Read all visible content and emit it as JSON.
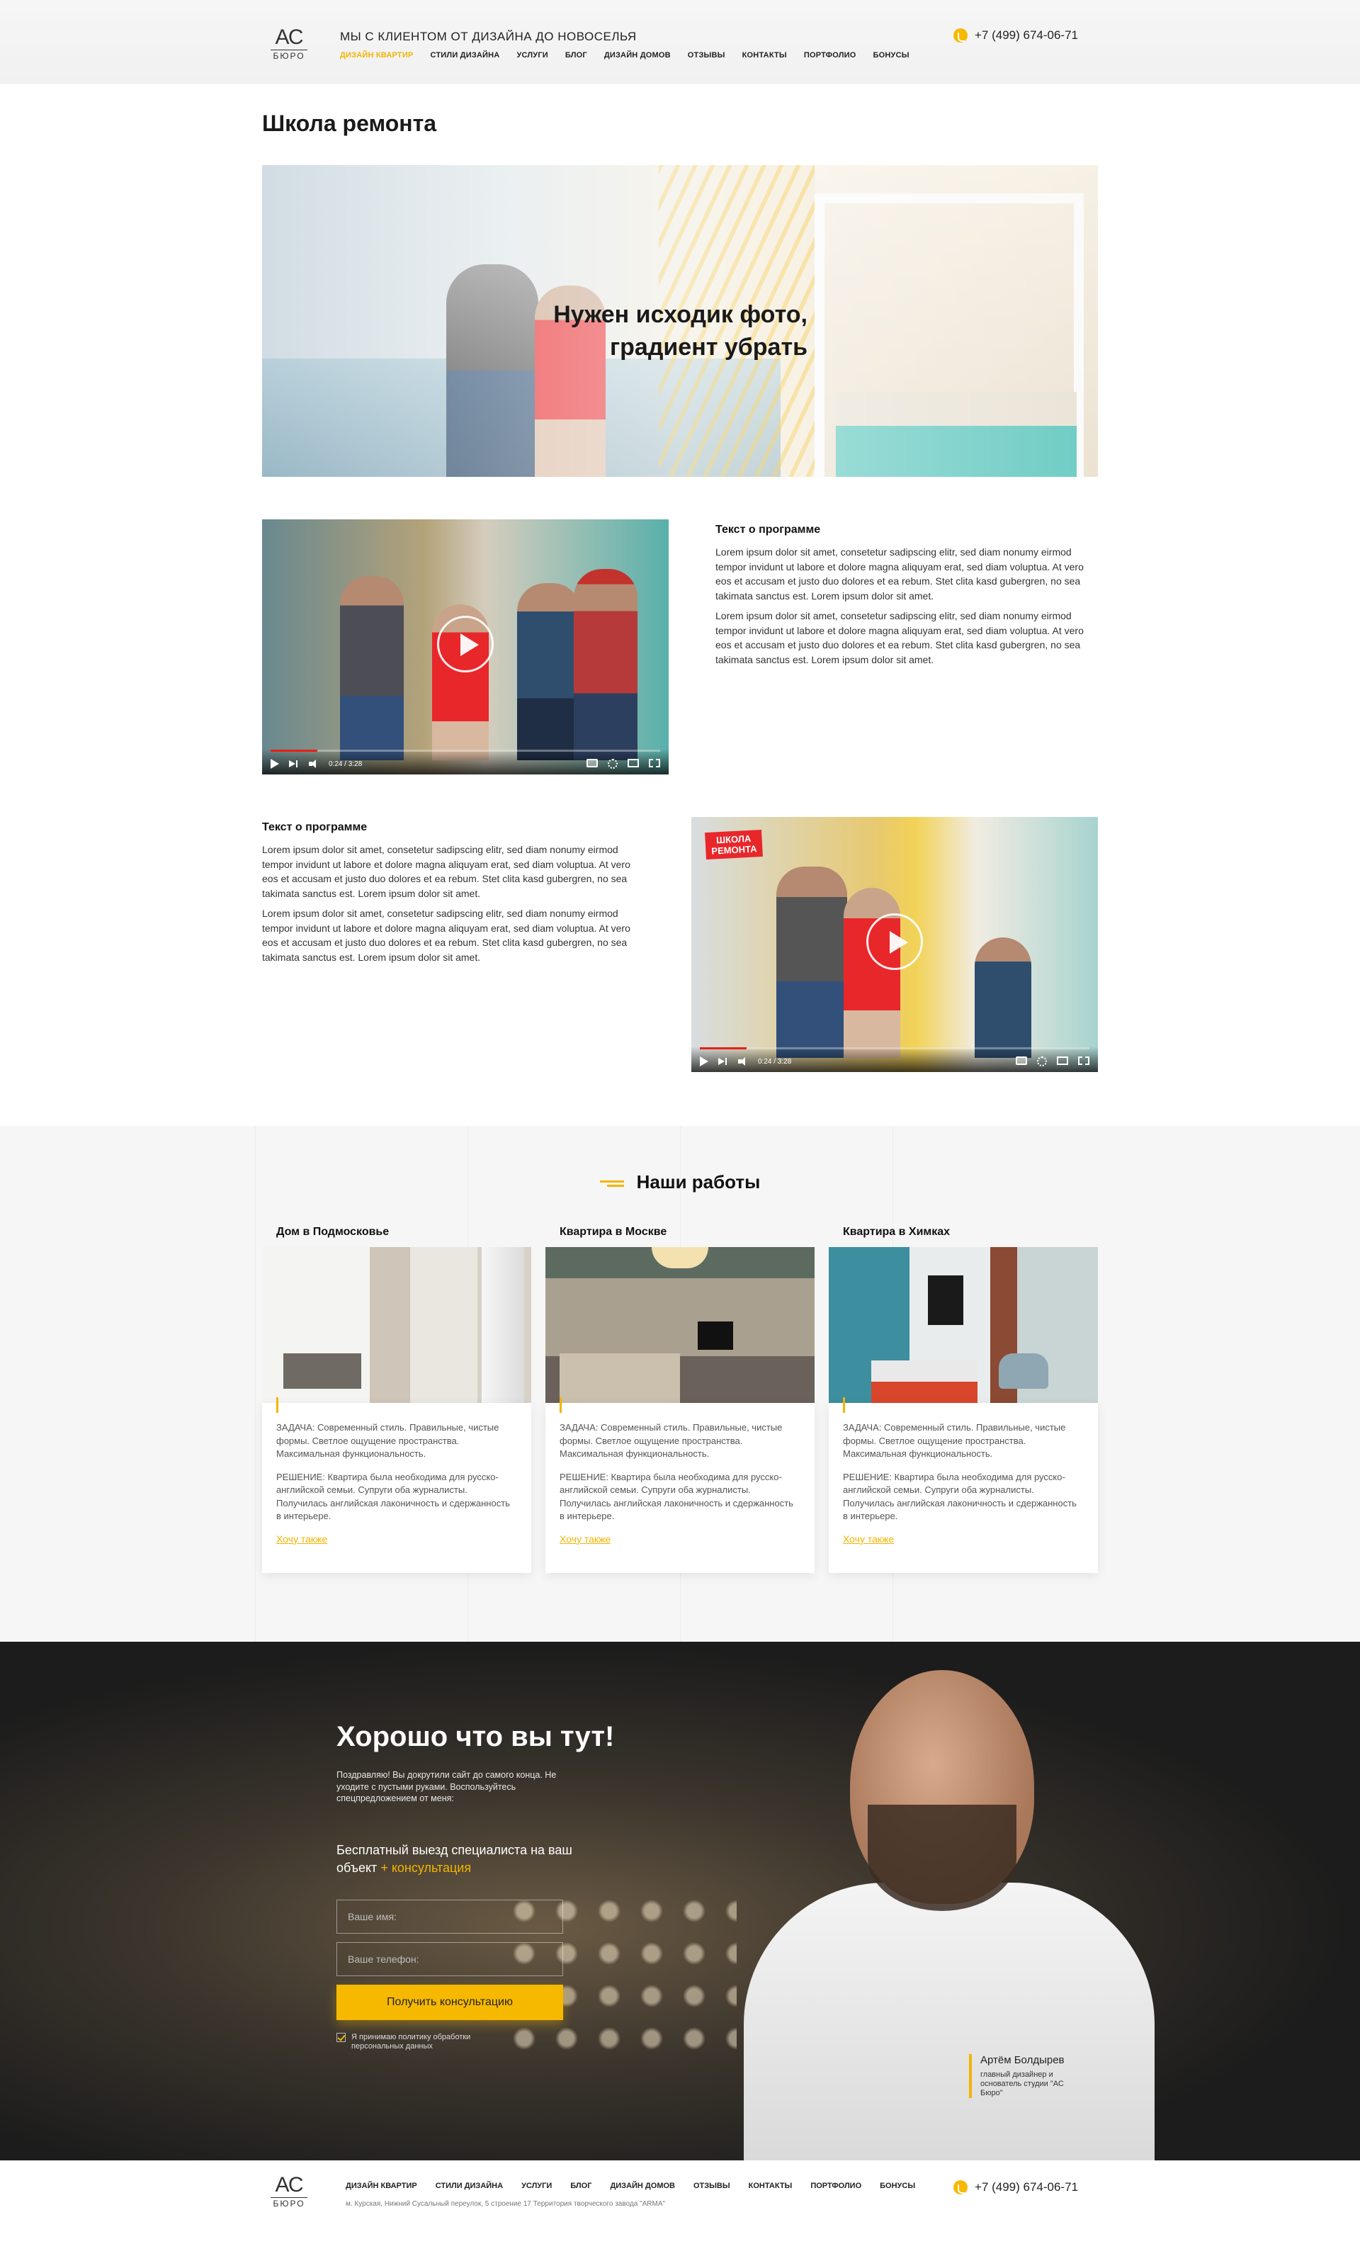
{
  "header": {
    "logo_top": "АС",
    "logo_bottom": "БЮРО",
    "tagline": "МЫ С КЛИЕНТОМ ОТ ДИЗАЙНА ДО НОВОСЕЛЬЯ",
    "phone": "+7 (499) 674-06-71",
    "nav": [
      "ДИЗАЙН КВАРТИР",
      "СТИЛИ ДИЗАЙНА",
      "УСЛУГИ",
      "БЛОГ",
      "ДИЗАЙН ДОМОВ",
      "ОТЗЫВЫ",
      "КОНТАКТЫ",
      "ПОРТФОЛИО",
      "БОНУСЫ"
    ],
    "active_nav": "ДИЗАЙН КВАРТИР"
  },
  "page_title": "Школа ремонта",
  "hero": {
    "note": "Нужен исходик фото,\nградиент убрать"
  },
  "program1": {
    "title": "Текст о программе",
    "p1": "Lorem ipsum dolor sit amet, consetetur sadipscing elitr, sed diam nonumy eirmod tempor invidunt ut labore et dolore magna aliquyam erat, sed diam voluptua. At vero eos et accusam et justo duo dolores et ea rebum. Stet clita kasd gubergren, no sea takimata sanctus est. Lorem ipsum dolor sit amet.",
    "p2": "Lorem ipsum dolor sit amet, consetetur sadipscing elitr, sed diam nonumy eirmod tempor invidunt ut labore et dolore magna aliquyam erat, sed diam voluptua. At vero eos et accusam et justo duo dolores et ea rebum. Stet clita kasd gubergren, no sea takimata sanctus est. Lorem ipsum dolor sit amet."
  },
  "program2": {
    "title": "Текст о программе",
    "p1": "Lorem ipsum dolor sit amet, consetetur sadipscing elitr, sed diam nonumy eirmod tempor invidunt ut labore et dolore magna aliquyam erat, sed diam voluptua. At vero eos et accusam et justo duo dolores et ea rebum. Stet clita kasd gubergren, no sea takimata sanctus est. Lorem ipsum dolor sit amet.",
    "p2": "Lorem ipsum dolor sit amet, consetetur sadipscing elitr, sed diam nonumy eirmod tempor invidunt ut labore et dolore magna aliquyam erat, sed diam voluptua. At vero eos et accusam et justo duo dolores et ea rebum. Stet clita kasd gubergren, no sea takimata sanctus est. Lorem ipsum dolor sit amet."
  },
  "video1": {
    "time": "0:24 / 3:28",
    "progress": 0.12
  },
  "video2": {
    "time": "0:24 / 3:28",
    "progress": 0.12,
    "badge": "ШКОЛА\nРЕМОНТА"
  },
  "works": {
    "title": "Наши работы",
    "cards": [
      {
        "title": "Дом в Подмосковье",
        "task": "ЗАДАЧА: Современный стиль. Правильные, чистые формы. Светлое ощущение пространства. Максимальная функциональность.",
        "solution": "РЕШЕНИЕ: Квартира была необходима для русско-английской семьи. Супруги оба журналисты. Получилась английская лаконичность и сдержанность в интерьере.",
        "link": "Хочу также"
      },
      {
        "title": "Квартира в Москве",
        "task": "ЗАДАЧА: Современный стиль. Правильные, чистые формы. Светлое ощущение пространства. Максимальная функциональность.",
        "solution": "РЕШЕНИЕ: Квартира была необходима для русско-английской семьи. Супруги оба журналисты. Получилась английская лаконичность и сдержанность в интерьере.",
        "link": "Хочу также"
      },
      {
        "title": "Квартира в Химках",
        "task": "ЗАДАЧА: Современный стиль. Правильные, чистые формы. Светлое ощущение пространства. Максимальная функциональность.",
        "solution": "РЕШЕНИЕ: Квартира была необходима для русско-английской семьи. Супруги оба журналисты. Получилась английская лаконичность и сдержанность в интерьере.",
        "link": "Хочу также"
      }
    ]
  },
  "cta": {
    "title": "Хорошо что вы тут!",
    "intro": "Поздравляю! Вы докрутили сайт до самого конца. Не уходите с пустыми руками. Воспользуйтесь спецпредложением от меня:",
    "offer_main": "Бесплатный выезд специалиста на ваш объект ",
    "offer_highlight": "+ консультация",
    "name_placeholder": "Ваше имя:",
    "phone_placeholder": "Ваше телефон:",
    "button": "Получить консультацию",
    "agree": "Я принимаю политику обработки персональных данных",
    "person_name": "Артём Болдырев",
    "person_role": "главный дизайнер и основатель студии \"АС Бюро\""
  },
  "footer": {
    "nav": [
      "ДИЗАЙН КВАРТИР",
      "СТИЛИ ДИЗАЙНА",
      "УСЛУГИ",
      "БЛОГ",
      "ДИЗАЙН ДОМОВ",
      "ОТЗЫВЫ",
      "КОНТАКТЫ",
      "ПОРТФОЛИО",
      "БОНУСЫ"
    ],
    "address": "м. Курская, Нижний Сусальный переулок, 5 строение 17  Территория творческого завода \"ARMA\"",
    "phone": "+7 (499) 674-06-71"
  },
  "colors": {
    "accent": "#f2b400",
    "cta_button": "#f6b900",
    "badge": "#e8272b"
  },
  "icons": [
    "phone-icon",
    "play-icon",
    "next-icon",
    "volume-icon",
    "subtitles-icon",
    "settings-icon",
    "theater-icon",
    "fullscreen-icon",
    "checkbox-icon"
  ]
}
